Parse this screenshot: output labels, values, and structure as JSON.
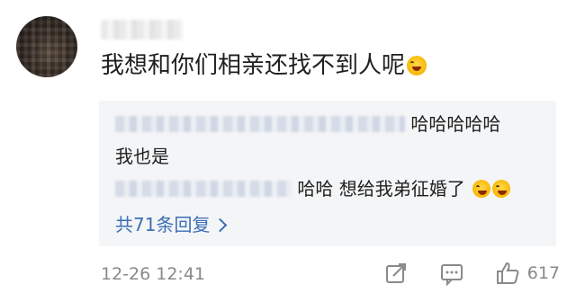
{
  "comment": {
    "main_text": "我想和你们相亲还找不到人呢",
    "main_emoji": "laugh-cry-emoji",
    "time": "12-26 12:41",
    "like_count": "617"
  },
  "replies": [
    {
      "name_prefix": "",
      "text": "哈哈哈哈哈"
    },
    {
      "name_prefix": "",
      "text": "我也是"
    },
    {
      "name_prefix": "",
      "text": "哈哈 想给我弟征婚了"
    }
  ],
  "reply_footer": {
    "more_label": "共71条回复"
  },
  "colors": {
    "link": "#3b6fb6",
    "meta": "#8a8a8a",
    "reply_bg": "#f4f5f7",
    "text": "#1f1f1f"
  },
  "icons": [
    "share-icon",
    "comment-icon",
    "like-icon",
    "chevron-right-icon"
  ]
}
